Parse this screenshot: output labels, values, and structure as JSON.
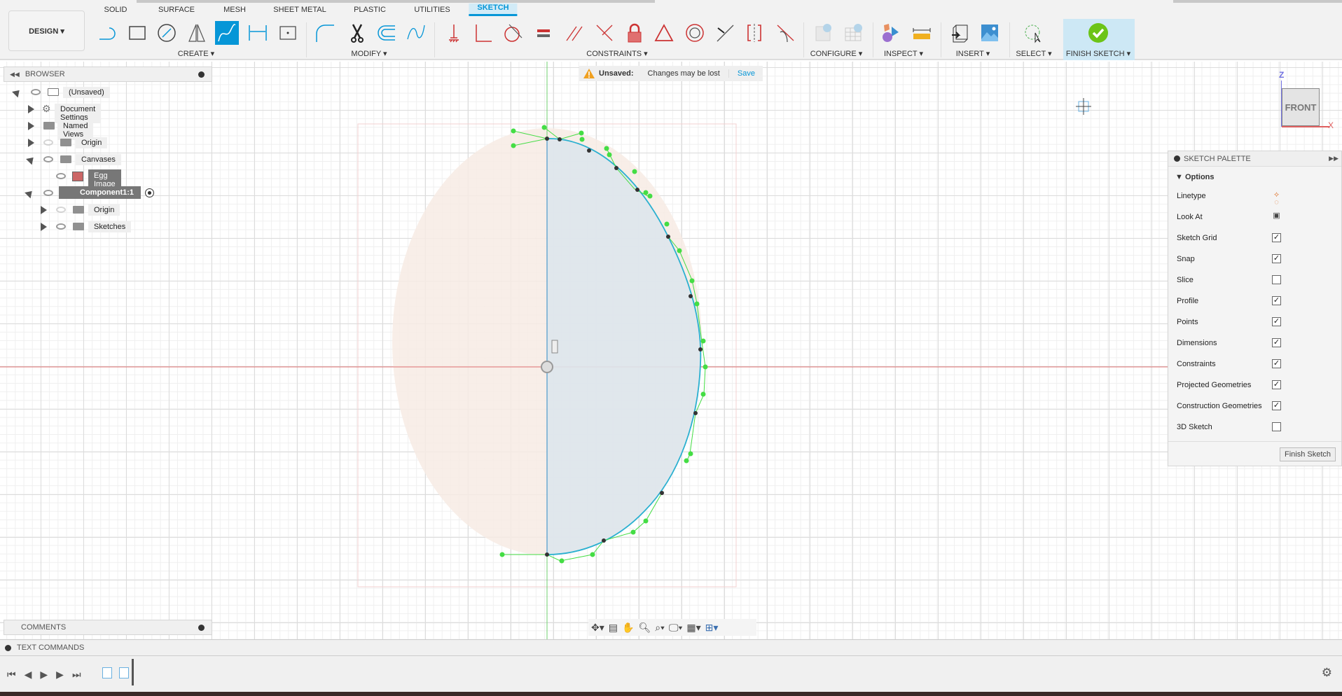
{
  "toolbar": {
    "design_label": "DESIGN ▾",
    "tabs": [
      "SOLID",
      "SURFACE",
      "MESH",
      "SHEET METAL",
      "PLASTIC",
      "UTILITIES",
      "SKETCH"
    ],
    "active_tab": "SKETCH",
    "groups": {
      "create": "CREATE ▾",
      "modify": "MODIFY ▾",
      "constraints": "CONSTRAINTS ▾",
      "configure": "CONFIGURE ▾",
      "inspect": "INSPECT ▾",
      "insert": "INSERT ▾",
      "select": "SELECT ▾",
      "finish": "FINISH SKETCH ▾"
    }
  },
  "notice": {
    "title": "Unsaved:",
    "message": "Changes may be lost",
    "save": "Save"
  },
  "browser": {
    "title": "BROWSER",
    "items": [
      {
        "label": "(Unsaved)"
      },
      {
        "label": "Document Settings"
      },
      {
        "label": "Named Views"
      },
      {
        "label": "Origin"
      },
      {
        "label": "Canvases"
      },
      {
        "label": "Egg Image"
      },
      {
        "label": "Component1:1"
      },
      {
        "label": "Origin"
      },
      {
        "label": "Sketches"
      }
    ]
  },
  "viewcube": {
    "face": "FRONT",
    "axis_z": "Z",
    "axis_x": "X"
  },
  "palette": {
    "title": "SKETCH PALETTE",
    "section": "Options",
    "options": [
      {
        "label": "Linetype",
        "type": "icons"
      },
      {
        "label": "Look At",
        "type": "icon"
      },
      {
        "label": "Sketch Grid",
        "checked": true
      },
      {
        "label": "Snap",
        "checked": true
      },
      {
        "label": "Slice",
        "checked": false
      },
      {
        "label": "Profile",
        "checked": true
      },
      {
        "label": "Points",
        "checked": true
      },
      {
        "label": "Dimensions",
        "checked": true
      },
      {
        "label": "Constraints",
        "checked": true
      },
      {
        "label": "Projected Geometries",
        "checked": true
      },
      {
        "label": "Construction Geometries",
        "checked": true
      },
      {
        "label": "3D Sketch",
        "checked": false
      }
    ],
    "finish_button": "Finish Sketch"
  },
  "comments": {
    "title": "COMMENTS"
  },
  "text_commands": {
    "title": "TEXT COMMANDS"
  },
  "colors": {
    "accent": "#0696d7",
    "finish_green": "#6cc417",
    "x_axis": "#e06060",
    "z_axis": "#70d070",
    "spline": "#2ab0d0",
    "control": "#44dd44"
  }
}
